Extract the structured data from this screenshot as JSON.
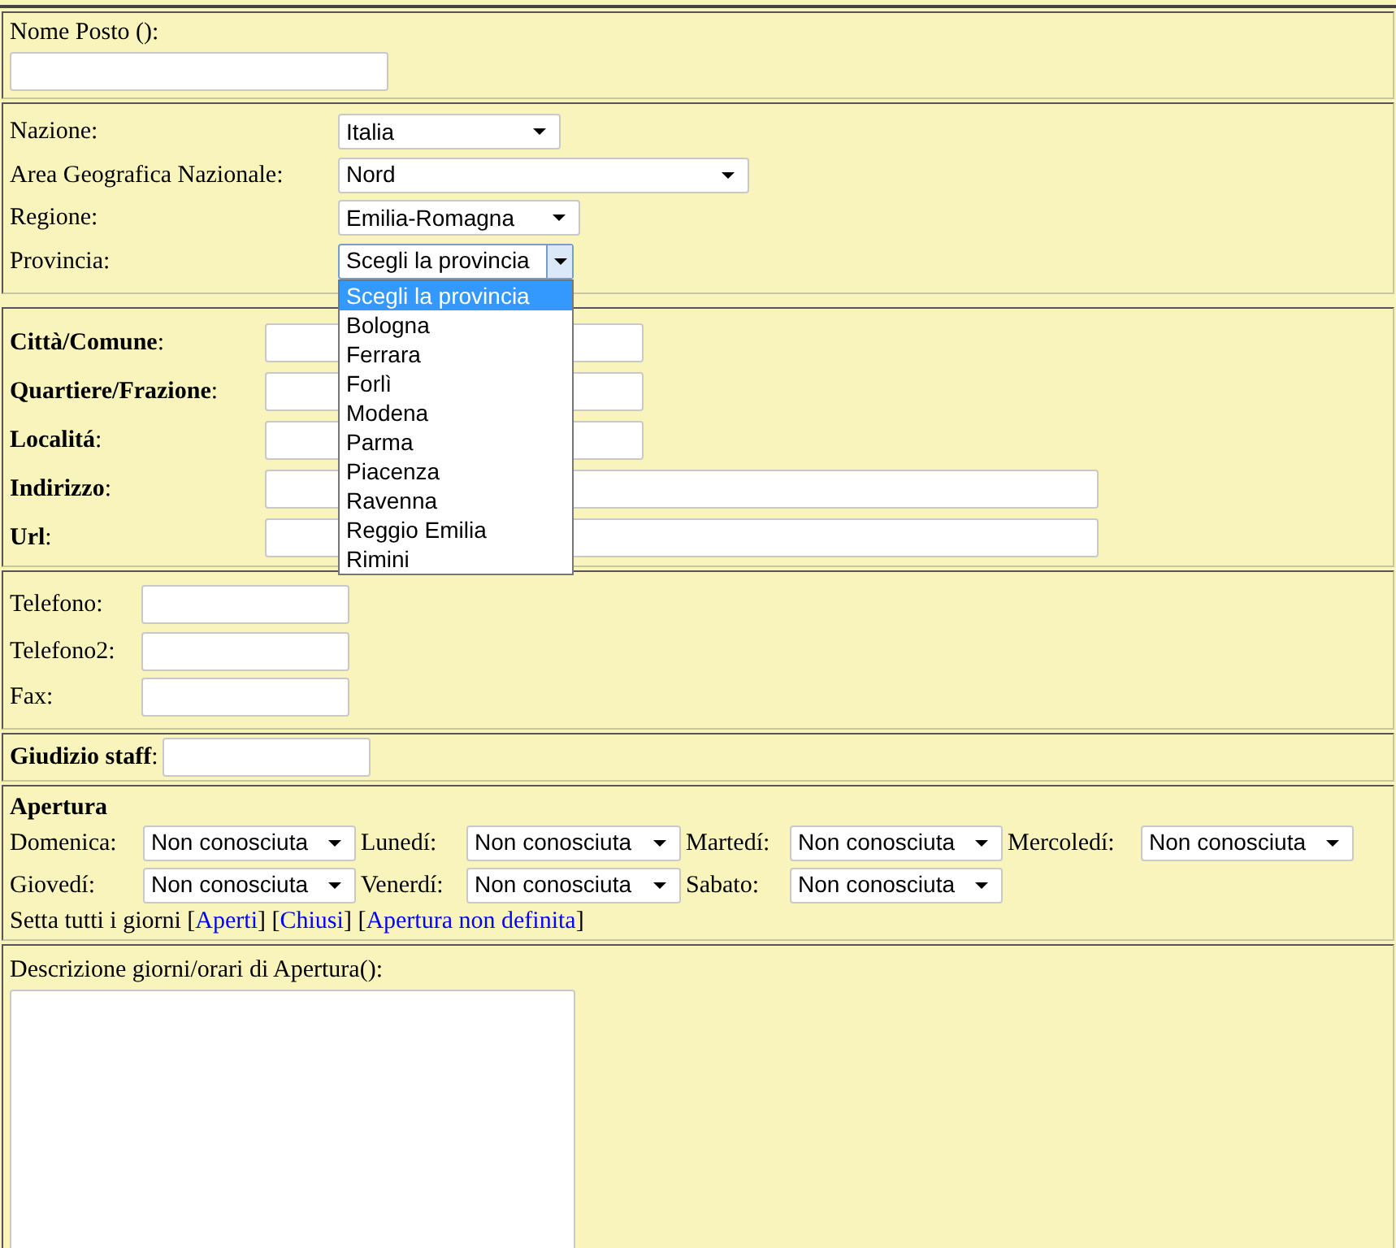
{
  "name_section": {
    "label": "Nome Posto ():"
  },
  "location": {
    "rows": [
      {
        "label": "Nazione:",
        "value": "Italia",
        "kind": "narrow",
        "expanded": false
      },
      {
        "label": "Area Geografica Nazionale:",
        "value": "Nord",
        "kind": "wide",
        "expanded": false
      },
      {
        "label": "Regione:",
        "value": "Emilia-Romagna",
        "kind": "narrow",
        "expanded": false
      },
      {
        "label": "Provincia:",
        "value": "Scegli la provincia",
        "kind": "narrow",
        "expanded": true,
        "options": [
          {
            "label": "Scegli la provincia",
            "selected": true
          },
          {
            "label": "Bologna",
            "selected": false
          },
          {
            "label": "Ferrara",
            "selected": false
          },
          {
            "label": "Forlì",
            "selected": false
          },
          {
            "label": "Modena",
            "selected": false
          },
          {
            "label": "Parma",
            "selected": false
          },
          {
            "label": "Piacenza",
            "selected": false
          },
          {
            "label": "Ravenna",
            "selected": false
          },
          {
            "label": "Reggio Emilia",
            "selected": false
          },
          {
            "label": "Rimini",
            "selected": false
          }
        ]
      }
    ]
  },
  "address": {
    "fields": [
      {
        "label": "**Città/Comune**:",
        "kind": "short"
      },
      {
        "label": "**Quartiere/Frazione**:",
        "kind": "short"
      },
      {
        "label": "**Localitá**:",
        "kind": "short"
      },
      {
        "label": "**Indirizzo**:",
        "kind": "long"
      },
      {
        "label": "**Url**:",
        "kind": "long"
      }
    ]
  },
  "contacts": {
    "fields": [
      {
        "label": "Telefono:"
      },
      {
        "label": "Telefono2:"
      },
      {
        "label": "Fax:"
      }
    ]
  },
  "staff": {
    "label": "**Giudizio staff**:"
  },
  "opening": {
    "title": "Apertura",
    "day_rows": [
      [
        {
          "label": "Domenica:",
          "value": "Non conosciuta"
        },
        {
          "label": "Lunedí:",
          "value": "Non conosciuta"
        },
        {
          "label": "Martedí:",
          "value": "Non conosciuta"
        },
        {
          "label": "Mercoledí:",
          "value": "Non conosciuta"
        }
      ],
      [
        {
          "label": "Giovedí:",
          "value": "Non conosciuta"
        },
        {
          "label": "Venerdí:",
          "value": "Non conosciuta"
        },
        {
          "label": "Sabato:",
          "value": "Non conosciuta"
        }
      ]
    ],
    "set_all": {
      "prefix": "Setta tutti i giorni",
      "bracket_open": "[",
      "bracket_close": "]",
      "links": [
        "Aperti",
        "Chiusi",
        "Apertura non definita"
      ]
    }
  },
  "description": {
    "label": "Descrizione giorni/orari di Apertura():"
  }
}
